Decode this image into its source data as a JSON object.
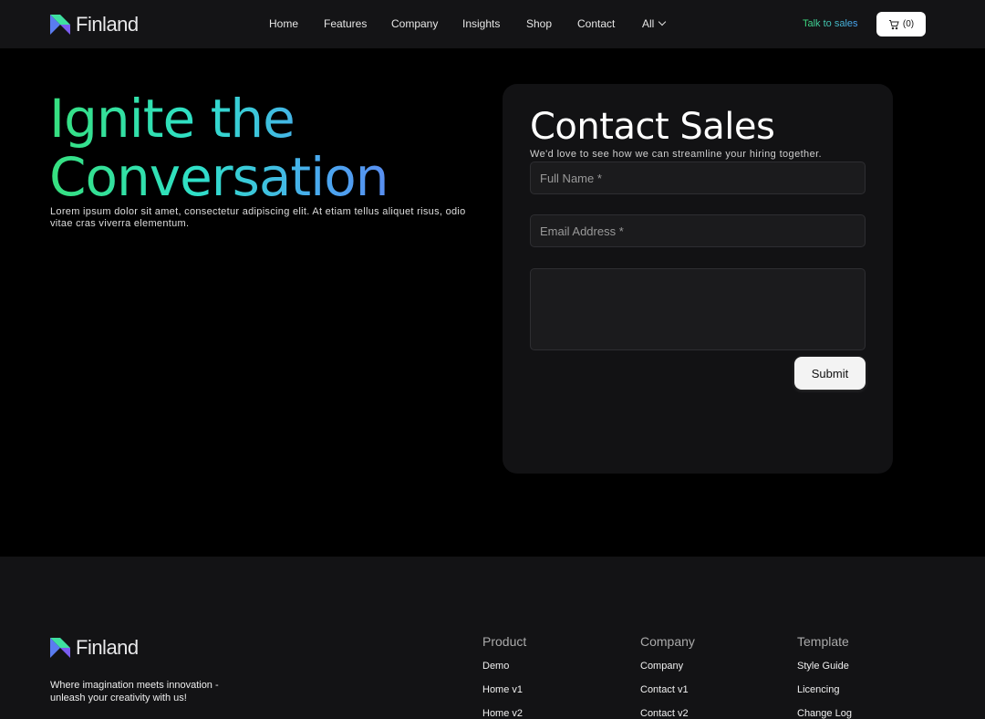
{
  "brand": {
    "name": "Finland",
    "logo_icon": "finland-logo-icon"
  },
  "nav": {
    "items": [
      {
        "label": "Home"
      },
      {
        "label": "Features"
      },
      {
        "label": "Company"
      },
      {
        "label": "Insights"
      },
      {
        "label": "Shop"
      },
      {
        "label": "Contact"
      },
      {
        "label": "All"
      }
    ],
    "talk_to_sales": "Talk to sales",
    "cart_count": "(0)"
  },
  "hero": {
    "title_line1": "Ignite the",
    "title_line2": "Conversation",
    "subtitle": "Lorem ipsum dolor sit amet, consectetur adipiscing elit. At etiam tellus aliquet risus, odio vitae cras viverra elementum."
  },
  "contact": {
    "title": "Contact Sales",
    "subtitle": "We'd love to see how we can streamline your hiring together.",
    "full_name_placeholder": "Full Name *",
    "email_placeholder": "Email Address *",
    "message_placeholder": "",
    "submit_label": "Submit"
  },
  "footer": {
    "tagline": "Where imagination meets innovation - unleash your creativity with us!",
    "columns": [
      {
        "title": "Product",
        "links": [
          "Demo",
          "Home v1",
          "Home v2"
        ]
      },
      {
        "title": "Company",
        "links": [
          "Company",
          "Contact v1",
          "Contact v2"
        ]
      },
      {
        "title": "Template",
        "links": [
          "Style Guide",
          "Licencing",
          "Change Log"
        ]
      }
    ]
  },
  "colors": {
    "accent_green": "#36e07e",
    "accent_blue": "#4aa8f0",
    "accent_purple": "#6b6ef0"
  }
}
